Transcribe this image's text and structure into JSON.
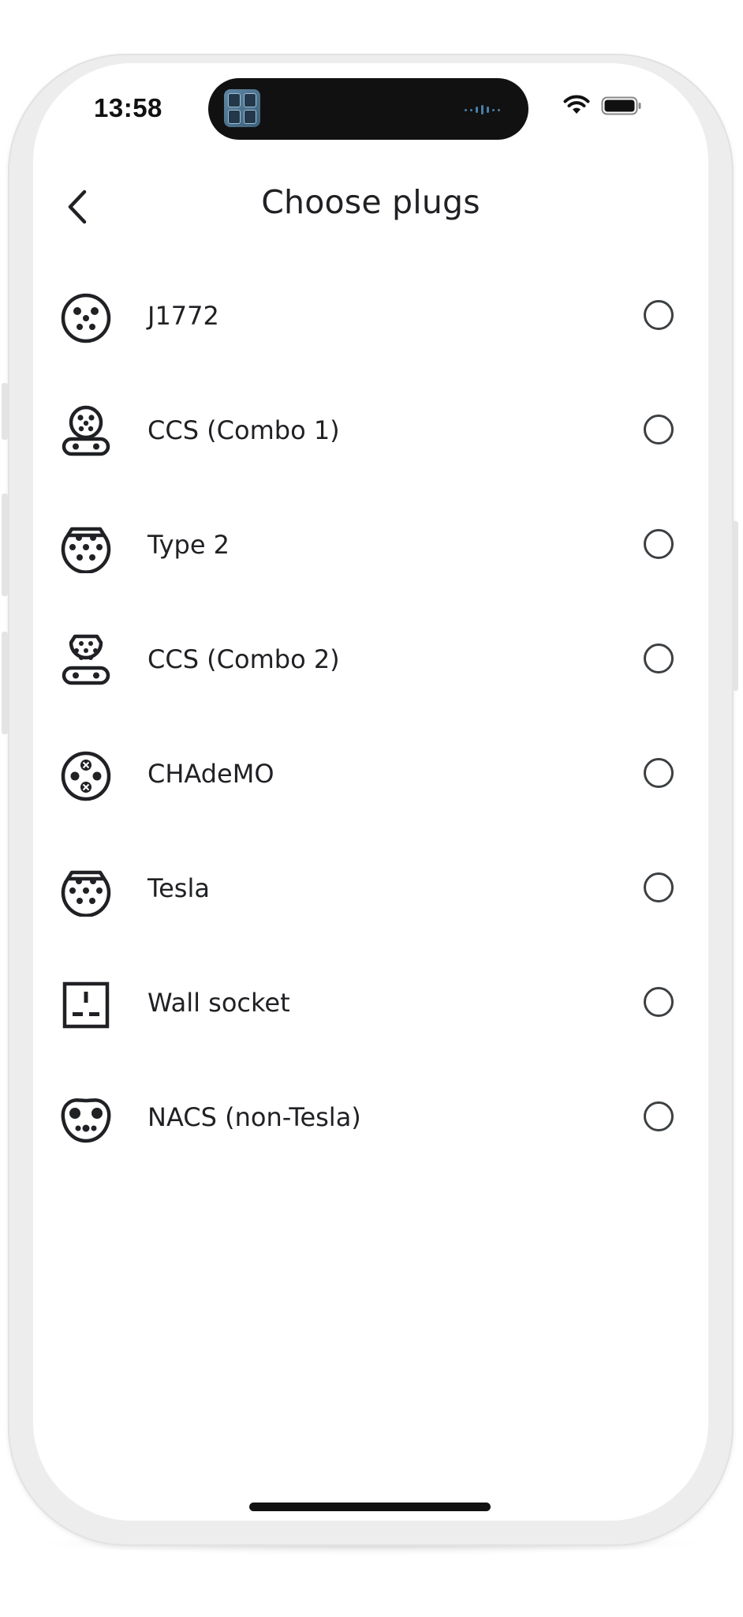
{
  "status_bar": {
    "time": "13:58"
  },
  "header": {
    "title": "Choose plugs",
    "back_icon": "chevron-left-icon"
  },
  "plugs": [
    {
      "label": "J1772",
      "icon": "j1772-plug-icon",
      "selected": false
    },
    {
      "label": "CCS (Combo 1)",
      "icon": "ccs-combo1-plug-icon",
      "selected": false
    },
    {
      "label": "Type 2",
      "icon": "type2-plug-icon",
      "selected": false
    },
    {
      "label": "CCS (Combo 2)",
      "icon": "ccs-combo2-plug-icon",
      "selected": false
    },
    {
      "label": "CHAdeMO",
      "icon": "chademo-plug-icon",
      "selected": false
    },
    {
      "label": "Tesla",
      "icon": "tesla-plug-icon",
      "selected": false
    },
    {
      "label": "Wall socket",
      "icon": "wall-socket-icon",
      "selected": false
    },
    {
      "label": "NACS (non-Tesla)",
      "icon": "nacs-plug-icon",
      "selected": false
    }
  ],
  "colors": {
    "text": "#202124",
    "icon": "#202124",
    "radio_border": "#3c4043",
    "background": "#ffffff"
  }
}
